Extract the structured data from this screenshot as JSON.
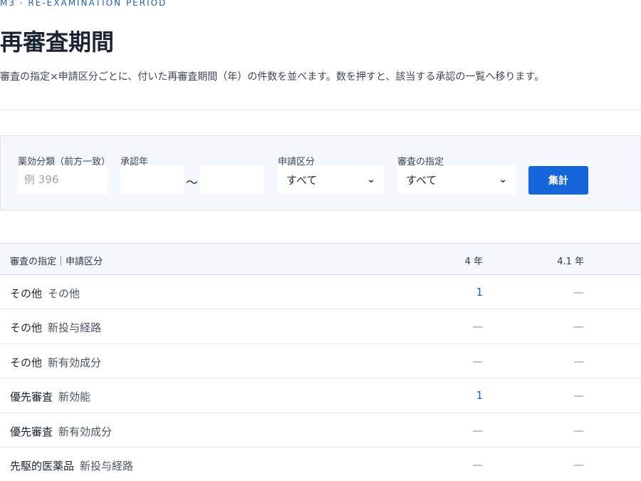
{
  "header": {
    "eyebrow": "M3 · RE-EXAMINATION PERIOD",
    "title": "再審査期間",
    "description": "審査の指定×申請区分ごとに、付いた再審査期間（年）の件数を並べます。数を押すと、該当する承認の一覧へ移ります。"
  },
  "filters": {
    "drug_class": {
      "label": "薬効分類（前方一致）",
      "placeholder": "例 396",
      "value": ""
    },
    "approval_year": {
      "label": "承認年",
      "from": "",
      "to": "",
      "separator": "〜"
    },
    "application_category": {
      "label": "申請区分",
      "selected": "すべて"
    },
    "review_designation": {
      "label": "審査の指定",
      "selected": "すべて"
    },
    "submit_label": "集計"
  },
  "table": {
    "header_label": "審査の指定｜申請区分",
    "columns": [
      "4 年",
      "4.1 年"
    ],
    "rows": [
      {
        "designation": "その他",
        "category": "その他",
        "cells": [
          "1",
          "—"
        ]
      },
      {
        "designation": "その他",
        "category": "新投与経路",
        "cells": [
          "—",
          "—"
        ]
      },
      {
        "designation": "その他",
        "category": "新有効成分",
        "cells": [
          "—",
          "—"
        ]
      },
      {
        "designation": "優先審査",
        "category": "新効能",
        "cells": [
          "1",
          "—"
        ]
      },
      {
        "designation": "優先審査",
        "category": "新有効成分",
        "cells": [
          "—",
          "—"
        ]
      },
      {
        "designation": "先駆的医薬品",
        "category": "新投与経路",
        "cells": [
          "—",
          "—"
        ]
      }
    ]
  },
  "colors": {
    "accent": "#1664d9",
    "link": "#1e5fb4"
  }
}
